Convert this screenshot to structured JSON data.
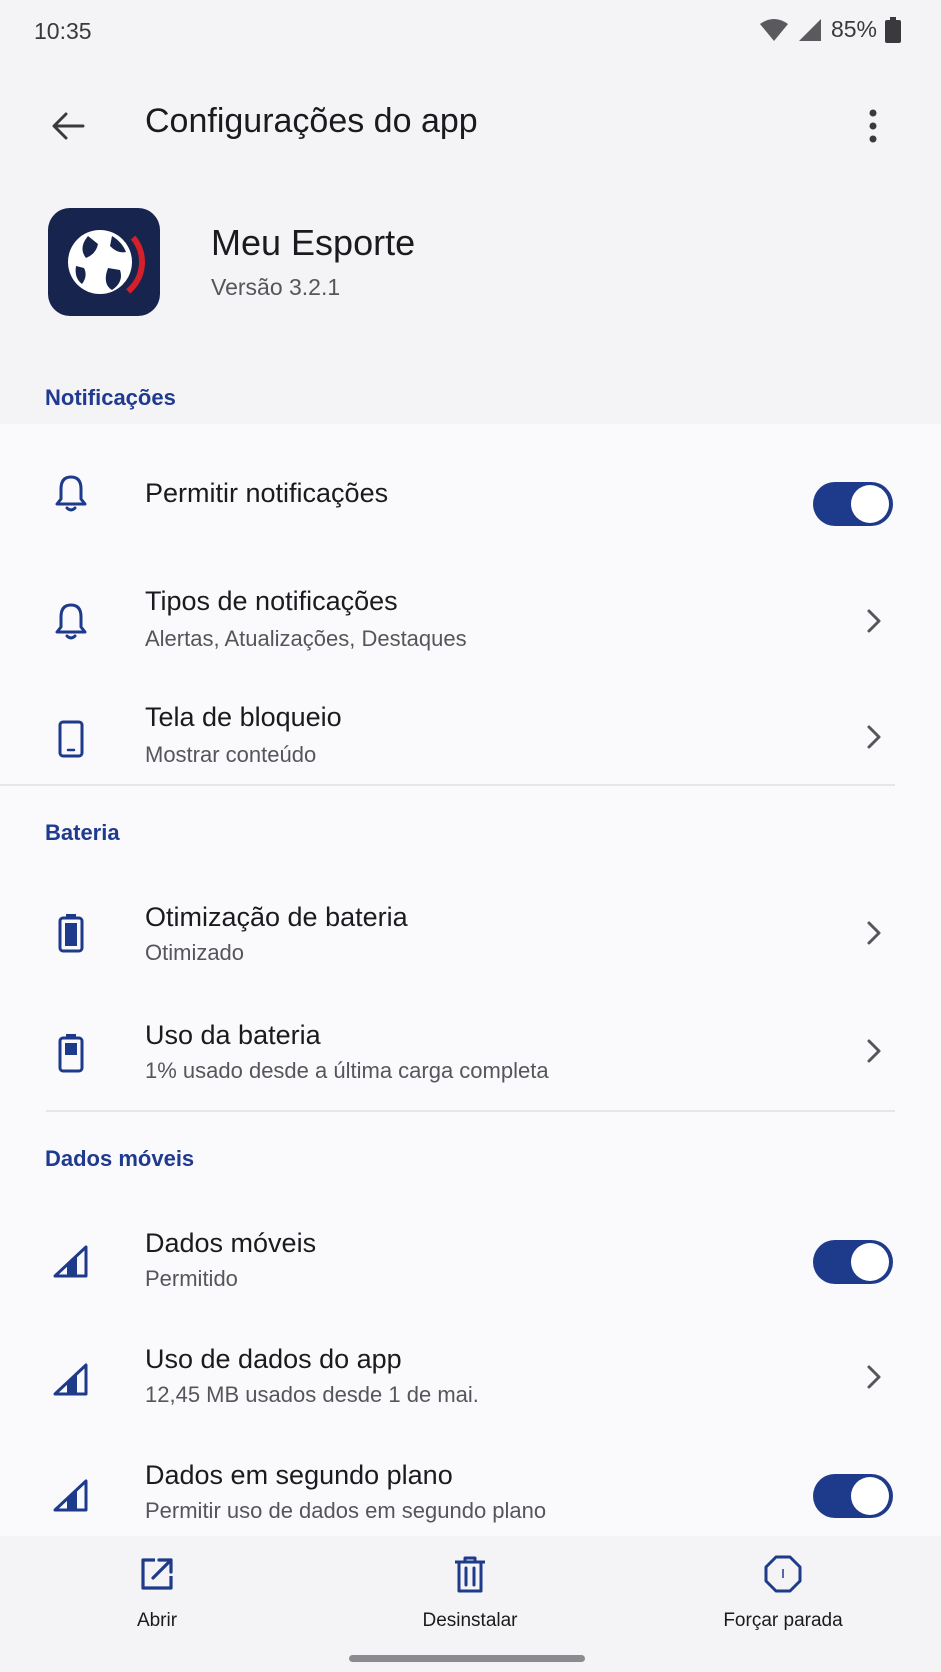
{
  "status": {
    "time": "10:35",
    "battery_pct": "85%"
  },
  "appbar": {
    "title": "Configurações do app",
    "back_icon": "arrow-left-icon",
    "more_icon": "more-vert-icon"
  },
  "app": {
    "name": "Meu Esporte",
    "version": "Versão 3.2.1"
  },
  "sections": {
    "notifications": {
      "label": "Notificações",
      "allow": {
        "title": "Permitir notificações",
        "enabled": true
      },
      "types": {
        "title": "Tipos de notificações",
        "subtitle": "Alertas, Atualizações, Destaques"
      },
      "lockscreen": {
        "title": "Tela de bloqueio",
        "subtitle": "Mostrar conteúdo"
      }
    },
    "battery": {
      "label": "Bateria",
      "optimization": {
        "title": "Otimização de bateria",
        "subtitle": "Otimizado"
      },
      "usage": {
        "title": "Uso da bateria",
        "subtitle": "1% usado desde a última carga completa"
      }
    },
    "mobile_data": {
      "label": "Dados móveis",
      "mobile": {
        "title": "Dados móveis",
        "subtitle": "Permitido",
        "enabled": true
      },
      "app_usage": {
        "title": "Uso de dados do app",
        "subtitle": "12,45 MB usados desde 1 de mai."
      },
      "background": {
        "title": "Dados em segundo plano",
        "subtitle": "Permitir uso de dados em segundo plano",
        "enabled": true
      }
    }
  },
  "bottom_actions": {
    "open": "Abrir",
    "uninstall": "Desinstalar",
    "force_stop": "Forçar parada"
  },
  "colors": {
    "accent": "#1e3a8a",
    "section_label": "#1f3a8f",
    "background": "#f4f4f6",
    "card": "#fafafc"
  }
}
